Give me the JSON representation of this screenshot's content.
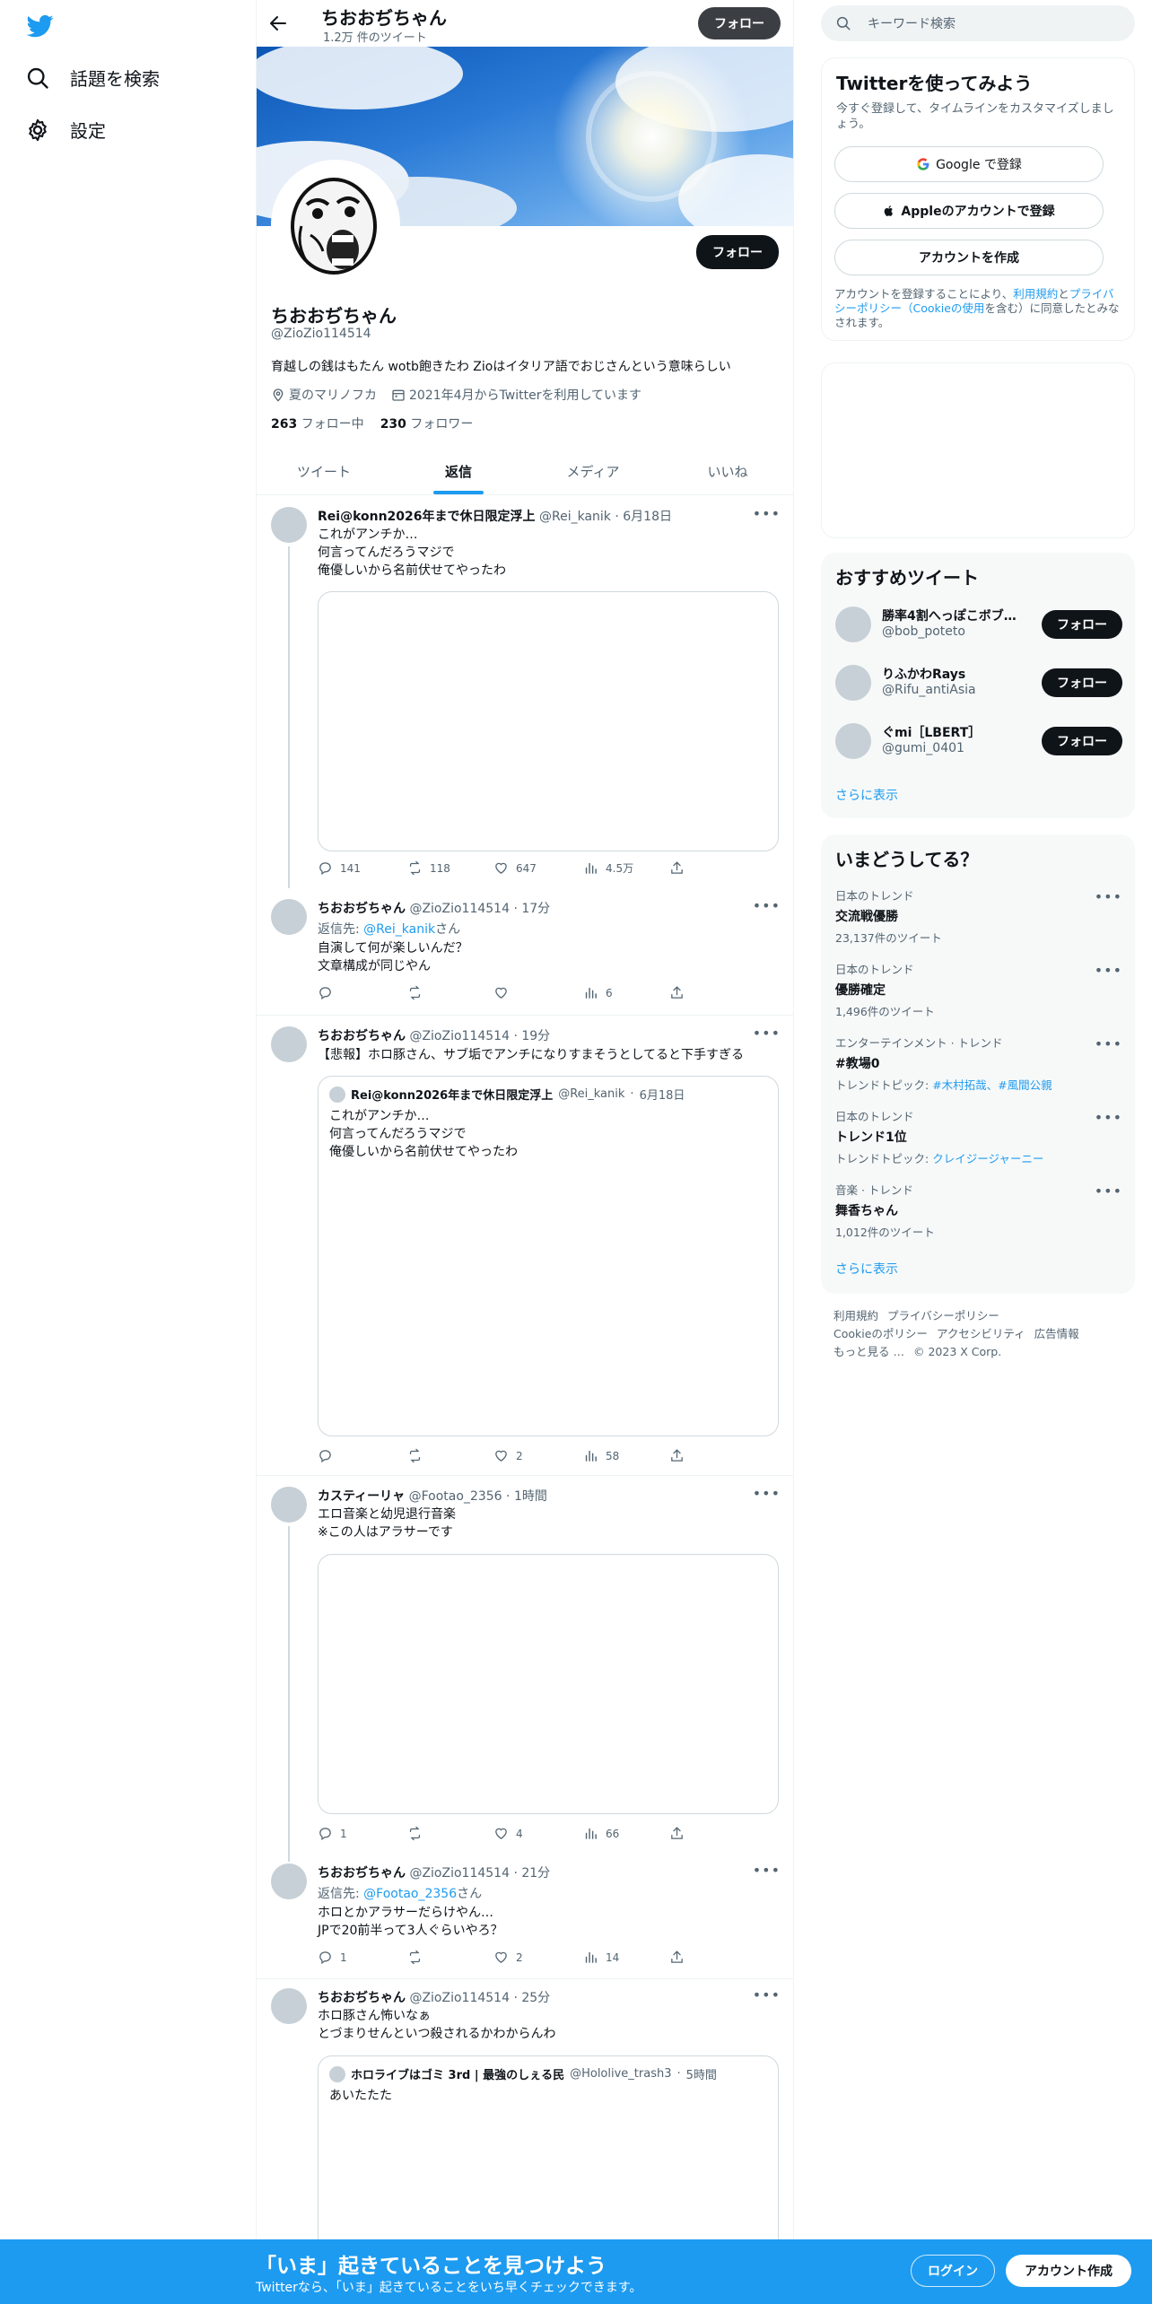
{
  "nav": {
    "explore_label": "話題を検索",
    "settings_label": "設定"
  },
  "header": {
    "name": "ちおおぢちゃん",
    "tweet_count": "1.2万 件のツイート",
    "follow_label": "フォロー"
  },
  "profile": {
    "name": "ちおおぢちゃん",
    "handle": "@ZioZio114514",
    "bio": "育越しの銭はもたん wotb飽きたわ Zioはイタリア語でおじさんという意味らしい",
    "location": "夏のマリノフカ",
    "joined": "2021年4月からTwitterを利用しています",
    "following_count": "263",
    "following_label": "フォロー中",
    "followers_count": "230",
    "followers_label": "フォロワー",
    "follow_label": "フォロー"
  },
  "tabs": [
    "ツイート",
    "返信",
    "メディア",
    "いいね"
  ],
  "tweets": [
    {
      "name": "Rei@konn2026年まで休日限定浮上",
      "handle": "@Rei_kanik",
      "time": "6月18日",
      "text": "これがアンチか…\n何言ってんだろうマジで\n俺優しいから名前伏せてやったわ",
      "replies": "141",
      "retweets": "118",
      "likes": "647",
      "views": "4.5万"
    },
    {
      "name": "ちおおぢちゃん",
      "handle": "@ZioZio114514",
      "time": "17分",
      "reply_prefix": "返信先: ",
      "reply_to": "@Rei_kanik",
      "reply_suffix": "さん",
      "text": "自演して何が楽しいんだ？\n文章構成が同じやん",
      "replies": "",
      "retweets": "",
      "likes": "",
      "views": "6"
    },
    {
      "name": "ちおおぢちゃん",
      "handle": "@ZioZio114514",
      "time": "19分",
      "text": "【悲報】ホロ豚さん、サブ垢でアンチになりすまそうとしてると下手すぎる",
      "quote": {
        "name": "Rei@konn2026年まで休日限定浮上",
        "handle": "@Rei_kanik",
        "time": "6月18日",
        "text": "これがアンチか…\n何言ってんだろうマジで\n俺優しいから名前伏せてやったわ"
      },
      "replies": "",
      "retweets": "",
      "likes": "2",
      "views": "58"
    },
    {
      "name": "カスティーリャ",
      "handle": "@Footao_2356",
      "time": "1時間",
      "text": "エロ音楽と幼児退行音楽\n※この人はアラサーです",
      "replies": "1",
      "retweets": "",
      "likes": "4",
      "views": "66"
    },
    {
      "name": "ちおおぢちゃん",
      "handle": "@ZioZio114514",
      "time": "21分",
      "reply_prefix": "返信先: ",
      "reply_to": "@Footao_2356",
      "reply_suffix": "さん",
      "text": "ホロとかアラサーだらけやん…\nJPで20前半って3人ぐらいやろ？",
      "replies": "1",
      "retweets": "",
      "likes": "2",
      "views": "14"
    },
    {
      "name": "ちおおぢちゃん",
      "handle": "@ZioZio114514",
      "time": "25分",
      "text": "ホロ豚さん怖いなぁ\nとづまりせんといつ殺されるかわからんわ",
      "quote": {
        "name": "ホロライブはゴミ 3rd | 最強のしぇる民",
        "handle": "@Hololive_trash3",
        "time": "5時間",
        "text": "あいたたた"
      }
    }
  ],
  "search": {
    "placeholder": "キーワード検索"
  },
  "signup": {
    "title": "Twitterを使ってみよう",
    "subtitle": "今すぐ登録して、タイムラインをカスタマイズしましょう。",
    "google_label": "Google で登録",
    "apple_label": "Appleのアカウントで登録",
    "create_label": "アカウントを作成",
    "legal_1": "アカウントを登録することにより、",
    "legal_terms": "利用規約",
    "legal_2": "と",
    "legal_privacy": "プライバシーポリシー（Cookieの使用",
    "legal_3": "を含む）に同意したとみなされます。"
  },
  "recommend": {
    "title": "おすすめツイート",
    "users": [
      {
        "name": "勝率4割へっぽこボブ…",
        "handle": "@bob_poteto"
      },
      {
        "name": "りふかわRays",
        "handle": "@Rifu_antiAsia"
      },
      {
        "name": "ぐmi［LBERT］",
        "handle": "@gumi_0401"
      }
    ],
    "follow_label": "フォロー",
    "more_label": "さらに表示"
  },
  "trends": {
    "title": "いまどうしてる？",
    "items": [
      {
        "category": "日本のトレンド",
        "name": "交流戦優勝",
        "sub": "23,137件のツイート"
      },
      {
        "category": "日本のトレンド",
        "name": "優勝確定",
        "sub": "1,496件のツイート"
      },
      {
        "category": "エンターテインメント · トレンド",
        "name": "#教場0",
        "sub_prefix": "トレンドトピック: ",
        "sub_link": "#木村拓哉、#風間公親"
      },
      {
        "category": "日本のトレンド",
        "name": "トレンド1位",
        "sub_prefix": "トレンドトピック: ",
        "sub_link": "クレイジージャーニー"
      },
      {
        "category": "音楽 · トレンド",
        "name": "舞香ちゃん",
        "sub": "1,012件のツイート"
      }
    ],
    "more_label": "さらに表示"
  },
  "footer": {
    "links": [
      "利用規約",
      "プライバシーポリシー",
      "Cookieのポリシー",
      "アクセシビリティ",
      "広告情報",
      "もっと見る …",
      "© 2023 X Corp."
    ]
  },
  "bottom_bar": {
    "title": "「いま」起きていることを見つけよう",
    "subtitle": "Twitterなら、「いま」起きていることをいち早くチェックできます。",
    "login_label": "ログイン",
    "signup_label": "アカウント作成"
  },
  "colors": {
    "accent": "#1d9bf0",
    "bottom_bar": "#1d9bf0",
    "text": "#0f1419",
    "muted": "#536471"
  }
}
